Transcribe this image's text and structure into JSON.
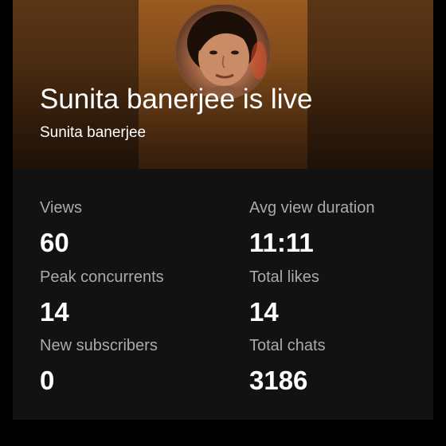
{
  "header": {
    "title": "Sunita banerjee is live",
    "channel_name": "Sunita banerjee"
  },
  "stats": {
    "views": {
      "label": "Views",
      "value": "60"
    },
    "avg_view_duration": {
      "label": "Avg view duration",
      "value": "11:11"
    },
    "peak_concurrents": {
      "label": "Peak concurrents",
      "value": "14"
    },
    "total_likes": {
      "label": "Total likes",
      "value": "14"
    },
    "new_subscribers": {
      "label": "New subscribers",
      "value": "0"
    },
    "total_chats": {
      "label": "Total chats",
      "value": "3186"
    }
  },
  "colors": {
    "page_background": "#000000",
    "stats_background": "#121212",
    "hero_tint": "#7a4718",
    "label_text": "#aaaaaa",
    "value_text": "#ffffff"
  },
  "icons": {
    "avatar": "profile-photo"
  }
}
